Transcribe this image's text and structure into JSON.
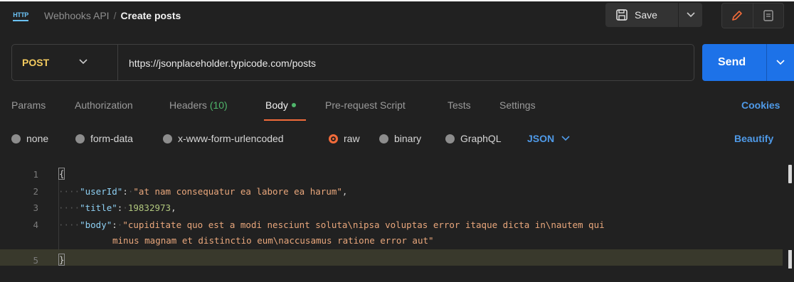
{
  "header": {
    "protocol_label": "HTTP",
    "collection": "Webhooks API",
    "separator": "/",
    "request_name": "Create posts",
    "save_label": "Save"
  },
  "request": {
    "method": "POST",
    "url": "https://jsonplaceholder.typicode.com/posts",
    "send_label": "Send"
  },
  "tabs": [
    {
      "label": "Params"
    },
    {
      "label": "Authorization"
    },
    {
      "label": "Headers",
      "count": "(10)"
    },
    {
      "label": "Body",
      "active": true
    },
    {
      "label": "Pre-request Script"
    },
    {
      "label": "Tests"
    },
    {
      "label": "Settings"
    }
  ],
  "cookies_label": "Cookies",
  "body_types": [
    {
      "label": "none"
    },
    {
      "label": "form-data"
    },
    {
      "label": "x-www-form-urlencoded"
    },
    {
      "label": "raw",
      "selected": true
    },
    {
      "label": "binary"
    },
    {
      "label": "GraphQL"
    }
  ],
  "body_format": "JSON",
  "beautify_label": "Beautify",
  "editor": {
    "line_numbers": [
      "1",
      "2",
      "3",
      "4",
      "5"
    ],
    "open_brace": "{",
    "close_brace": "}",
    "lines": [
      {
        "key": "\"userId\"",
        "value": "\"at nam consequatur ea labore ea harum\"",
        "trail": ","
      },
      {
        "key": "\"title\"",
        "value": "19832973",
        "trail": ","
      },
      {
        "key": "\"body\"",
        "value": "\"cupiditate quo est a modi nesciunt soluta\\nipsa voluptas error itaque dicta in\\nautem qui",
        "trail": ""
      }
    ],
    "wrap_line": "minus magnam et distinctio eum\\naccusamus ratione error aut\""
  },
  "colors": {
    "accent": "#f26b3a",
    "send": "#1d72e8",
    "method": "#f4cb5f",
    "link": "#4f9ae8",
    "status_green": "#4fb66b"
  }
}
